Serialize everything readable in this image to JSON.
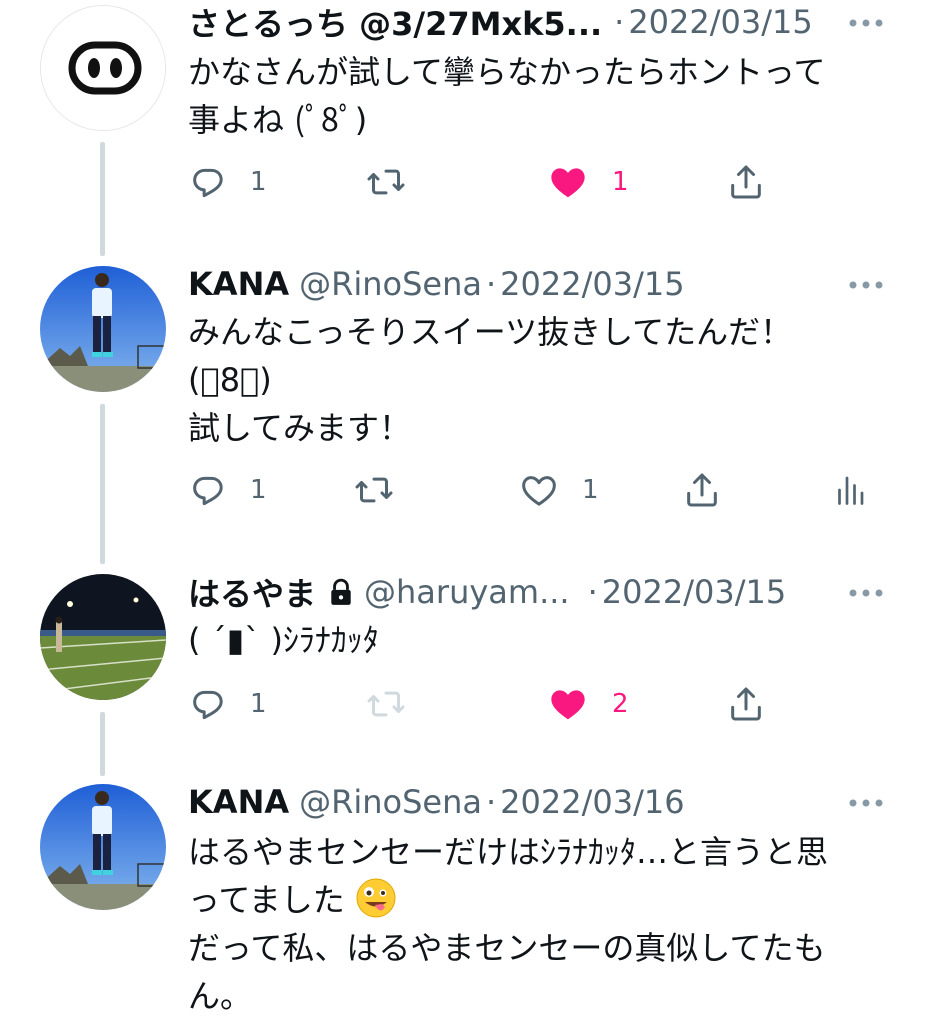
{
  "tweets": [
    {
      "name": "さとるっち @3/27Mxk5...",
      "handle": "",
      "date": "2022/03/15",
      "lines": [
        "かなさんが試して攣らなかったらホントって",
        "事よね (ﾟ8ﾟ)"
      ],
      "reply_count": "1",
      "retweet_count": "",
      "like_count": "1",
      "liked": true
    },
    {
      "name": "KANA",
      "handle": "@RinoSena",
      "date": "2022/03/15",
      "lines": [
        "みんなこっそりスイーツ抜きしてたんだ！",
        "(ﾟ8ﾟ)",
        "試してみます！"
      ],
      "reply_count": "1",
      "retweet_count": "",
      "like_count": "1",
      "liked": false
    },
    {
      "name": "はるやま",
      "handle": "@haruyam...",
      "date": "2022/03/15",
      "lines": [
        "( ´▮` )ｼﾗﾅｶｯﾀ"
      ],
      "reply_count": "1",
      "retweet_count": "",
      "like_count": "2",
      "liked": true
    },
    {
      "name": "KANA",
      "handle": "@RinoSena",
      "date": "2022/03/16",
      "lines": [
        "はるやまセンセーだけはｼﾗﾅｶｯﾀ…と言うと思",
        "ってました",
        "だって私、はるやまセンセーの真似してたも",
        "ん。"
      ],
      "reply_count": "",
      "retweet_count": "",
      "like_count": "",
      "liked": false
    }
  ],
  "separator_dot": "·",
  "colors": {
    "text": "#0f1419",
    "secondary": "#536471",
    "like": "#f91880",
    "thread_line": "#cfd9de"
  }
}
